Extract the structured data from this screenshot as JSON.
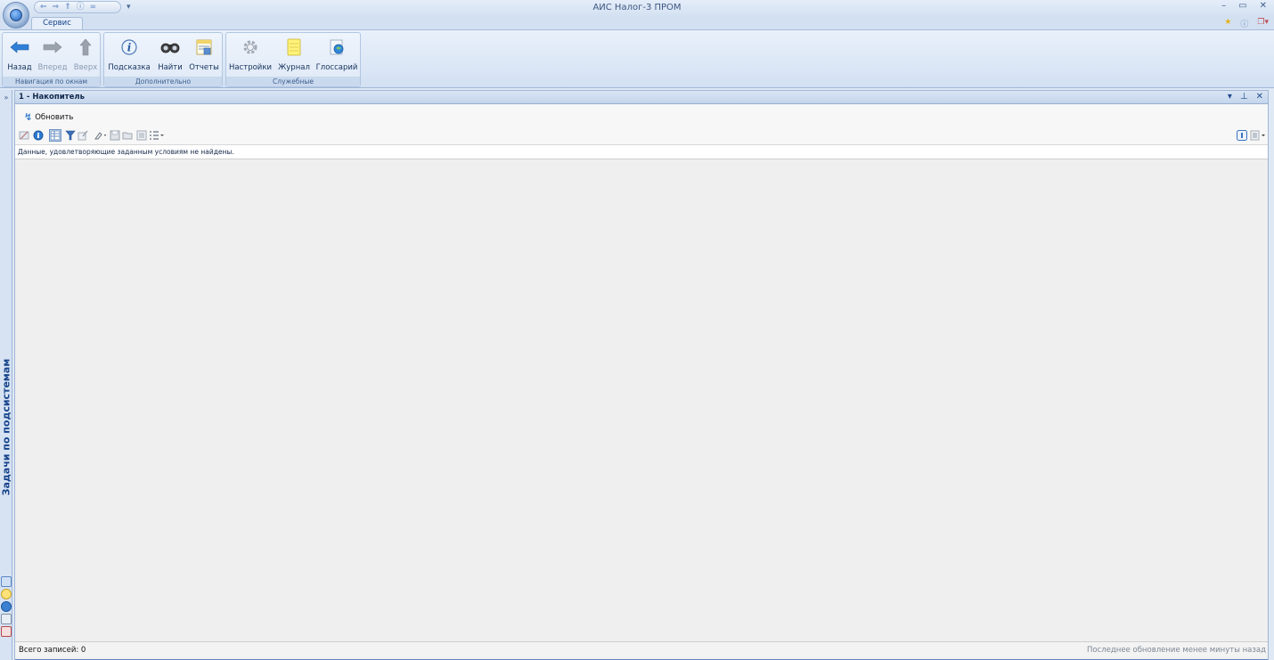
{
  "window": {
    "title": "АИС Налог-3 ПРОМ",
    "minimize": "–",
    "maximize": "▭",
    "close": "✕"
  },
  "ribbon": {
    "active_tab": "Сервис",
    "groups": [
      {
        "label": "Навигация по окнам",
        "buttons": [
          {
            "label": "Назад",
            "icon": "arrow-left-icon",
            "enabled": true
          },
          {
            "label": "Вперед",
            "icon": "arrow-right-icon",
            "enabled": false
          },
          {
            "label": "Вверх",
            "icon": "arrow-up-icon",
            "enabled": false
          }
        ]
      },
      {
        "label": "Дополнительно",
        "buttons": [
          {
            "label": "Подсказка",
            "icon": "info-icon",
            "enabled": true
          },
          {
            "label": "Найти",
            "icon": "binoculars-icon",
            "enabled": true
          },
          {
            "label": "Отчеты",
            "icon": "report-icon",
            "enabled": true
          }
        ]
      },
      {
        "label": "Служебные",
        "buttons": [
          {
            "label": "Настройки",
            "icon": "gear-icon",
            "enabled": true
          },
          {
            "label": "Журнал",
            "icon": "journal-icon",
            "enabled": true
          },
          {
            "label": "Глоссарий",
            "icon": "glossary-icon",
            "enabled": true
          }
        ]
      }
    ]
  },
  "side_pane": {
    "title": "Задачи по подсистемам",
    "expand": "»"
  },
  "document": {
    "title": "1 - Накопитель",
    "refresh_label": "Обновить",
    "empty_message": "Данные, удовлетворяющие заданным условиям не найдены.",
    "status_left": "Всего записей: 0",
    "status_right": "Последнее обновление менее минуты назад"
  },
  "colors": {
    "ribbon_text": "#15428b",
    "accent_blue": "#3d7fd0"
  }
}
